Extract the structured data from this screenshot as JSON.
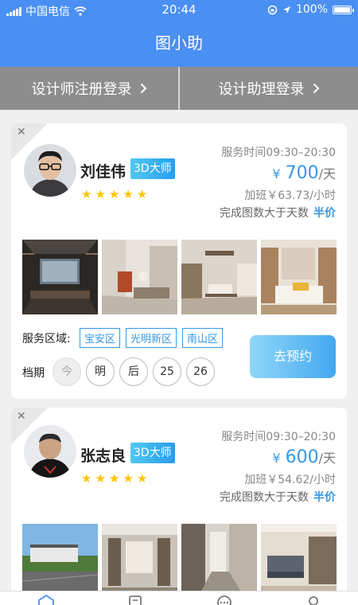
{
  "status_bar": {
    "carrier": "中国电信",
    "time": "20:44",
    "battery": "100%",
    "battery_level": 1.0
  },
  "nav": {
    "title": "图小助"
  },
  "login_bar": {
    "designer_login": "设计师注册登录",
    "assistant_login": "设计助理登录"
  },
  "designers": [
    {
      "name": "刘佳伟",
      "level": "3D大师",
      "rating": 5,
      "service_time": "服务时间09:30–20:30",
      "currency": "¥",
      "price": "700",
      "price_unit": "/天",
      "overtime": "加班￥63.73/小时",
      "completion": "完成图数大于天数",
      "half_price": "半价",
      "area_label": "服务区域:",
      "areas": [
        "宝安区",
        "光明新区",
        "南山区"
      ],
      "schedule_label": "档期",
      "days": [
        "今",
        "明",
        "后",
        "25",
        "26"
      ],
      "book_label": "去预约"
    },
    {
      "name": "张志良",
      "level": "3D大师",
      "rating": 5,
      "service_time": "服务时间09:30–20:30",
      "currency": "¥",
      "price": "600",
      "price_unit": "/天",
      "overtime": "加班￥54.62/小时",
      "completion": "完成图数大于天数",
      "half_price": "半价"
    }
  ],
  "icons": {
    "close": "close-icon",
    "star": "star-icon",
    "chevron": "chevron-right-icon"
  },
  "colors": {
    "primary": "#4a8ff2",
    "accent": "#3598e6",
    "star": "#ffc400",
    "login_bar": "#8d8d8d"
  }
}
